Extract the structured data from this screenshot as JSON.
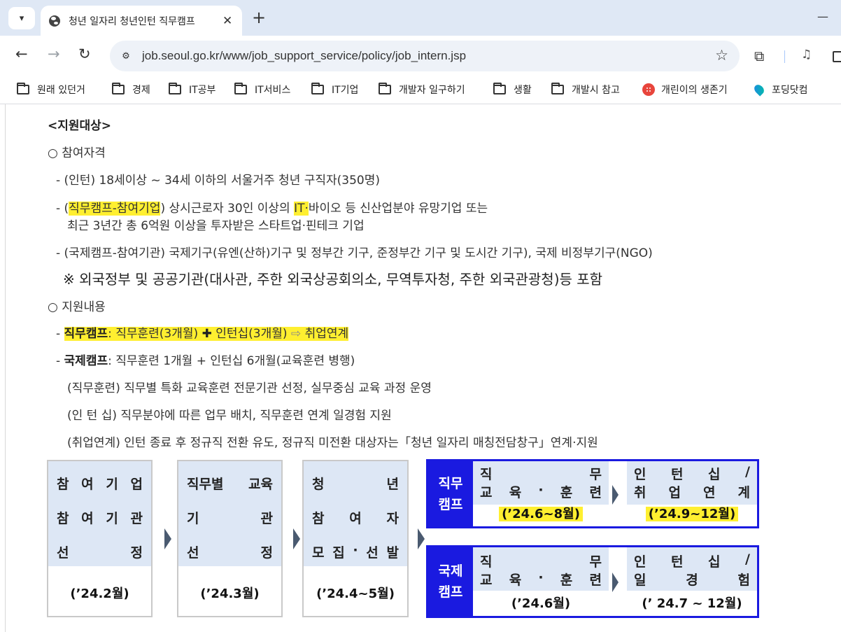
{
  "browser": {
    "tab_title": "청년 일자리 청년인턴 직무캠프",
    "tab_menu_icon": "▾",
    "close_glyph": "✕",
    "new_tab_glyph": "+",
    "minimize_glyph": "—",
    "back_glyph": "←",
    "forward_glyph": "→",
    "reload_glyph": "↻",
    "site_info_glyph": "⚙",
    "url": "job.seoul.go.kr/www/job_support_service/policy/job_intern.jsp",
    "star_glyph": "☆",
    "extensions_glyph": "⧉",
    "media_glyph": "♫"
  },
  "bookmarks": [
    {
      "label": "원래 있던거",
      "icon": "folder-icon"
    },
    {
      "label": "경제",
      "icon": "folder-icon"
    },
    {
      "label": "IT공부",
      "icon": "folder-icon"
    },
    {
      "label": "IT서비스",
      "icon": "folder-icon"
    },
    {
      "label": "IT기업",
      "icon": "folder-icon"
    },
    {
      "label": "개발자 일구하기",
      "icon": "folder-icon"
    },
    {
      "label": "생활",
      "icon": "folder-icon"
    },
    {
      "label": "개발시 참고",
      "icon": "folder-icon"
    },
    {
      "label": "개린이의 생존기",
      "icon": "red-dot-favicon"
    },
    {
      "label": "포딩닷컴",
      "icon": "drop-favicon"
    }
  ],
  "content": {
    "section_heading": "<지원대상>",
    "eligibility": {
      "title": "○ 참여자격",
      "intern_line": "- (인턴) 18세이상 ~ 34세 이하의 서울거주 청년 구직자(350명)",
      "job_camp_prefix": "- (",
      "job_camp_tag": "직무캠프-참여기업",
      "job_camp_mid": ") 상시근로자 30인 이상의 ",
      "job_camp_it": "IT·",
      "job_camp_rest": "바이오 등 신산업분야 유망기업 또는",
      "job_camp_line2": "최근 3년간 총 6억원 이상을 투자받은 스타트업·핀테크 기업",
      "intl_camp_line": "- (국제캠프-참여기관) 국제기구(유엔(산하)기구 및 정부간 기구, 준정부간 기구 및 도시간 기구), 국제 비정부기구(NGO)",
      "note_line": "※ 외국정부 및 공공기관(대사관, 주한 외국상공회의소, 무역투자청, 주한 외국관광청)등 포함"
    },
    "support": {
      "title": "○ 지원내용",
      "job_camp_dash": "- ",
      "job_camp_label": "직무캠프",
      "job_camp_detail_a": ": 직무훈련(3개월) ",
      "job_camp_plus": "✚",
      "job_camp_detail_b": " 인턴십(3개월) ",
      "job_camp_arrow": "⇨",
      "job_camp_detail_c": " 취업연계",
      "intl_camp_dash": "- ",
      "intl_camp_label": "국제캠프",
      "intl_camp_detail": ": 직무훈련 1개월 + 인턴십 6개월(교육훈련 병행)",
      "training_line": "(직무훈련) 직무별 특화 교육훈련 전문기관 선정, 실무중심 교육 과정 운영",
      "internship_line": "(인 턴 십) 직무분야에 따른 업무 배치, 직무훈련 연계 일경험 지원",
      "employment_line": "(취업연계) 인턴 종료 후 정규직 전환 유도, 정규직 미전환 대상자는「청년 일자리 매칭전담창구」연계·지원"
    }
  },
  "process": {
    "steps": [
      {
        "rows": [
          [
            "참",
            "여",
            "기",
            "업"
          ],
          [
            "참",
            "여",
            "기",
            "관"
          ],
          [
            "선",
            "정"
          ]
        ],
        "date": "(’24.2월)"
      },
      {
        "rows": [
          [
            "직무별",
            "교육"
          ],
          [
            "기",
            "관"
          ],
          [
            "선",
            "정"
          ]
        ],
        "date": "(’24.3월)"
      },
      {
        "rows": [
          [
            "청",
            "년"
          ],
          [
            "참",
            "여",
            "자"
          ],
          [
            "모",
            "집",
            "·",
            "선",
            "발"
          ]
        ],
        "date": "(’24.4~5월)"
      }
    ],
    "job_camp": {
      "label_line1": "직무",
      "label_line2": "캠프",
      "training": {
        "rows": [
          [
            "직",
            "무"
          ],
          [
            "교",
            "육",
            "·",
            "훈",
            "련"
          ]
        ],
        "date": "(’24.6~8월)"
      },
      "internship": {
        "rows": [
          [
            "인",
            "턴",
            "십",
            "/"
          ],
          [
            "취",
            "업",
            "연",
            "계"
          ]
        ],
        "date": "(’24.9~12월)"
      }
    },
    "intl_camp": {
      "label_line1": "국제",
      "label_line2": "캠프",
      "training": {
        "rows": [
          [
            "직",
            "무"
          ],
          [
            "교",
            "육",
            "·",
            "훈",
            "련"
          ]
        ],
        "date": "(’24.6월)"
      },
      "internship": {
        "rows": [
          [
            "인",
            "턴",
            "십",
            "/"
          ],
          [
            "일",
            "경",
            "험"
          ]
        ],
        "date": "(’ 24.7 ~ 12월)"
      }
    },
    "highlight_color": "#ffef30",
    "camp_color": "#1a1ae0",
    "band_color": "#dde7f5"
  }
}
